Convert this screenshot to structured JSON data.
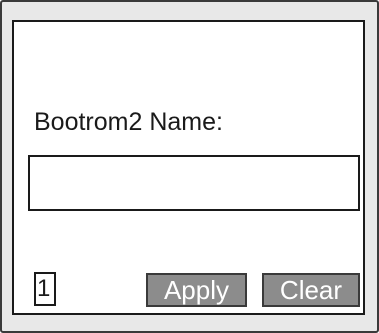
{
  "form": {
    "label": "Bootrom2 Name:",
    "name_value": "",
    "name_placeholder": ""
  },
  "footer": {
    "page_indicator": "1",
    "apply_label": "Apply",
    "clear_label": "Clear"
  }
}
